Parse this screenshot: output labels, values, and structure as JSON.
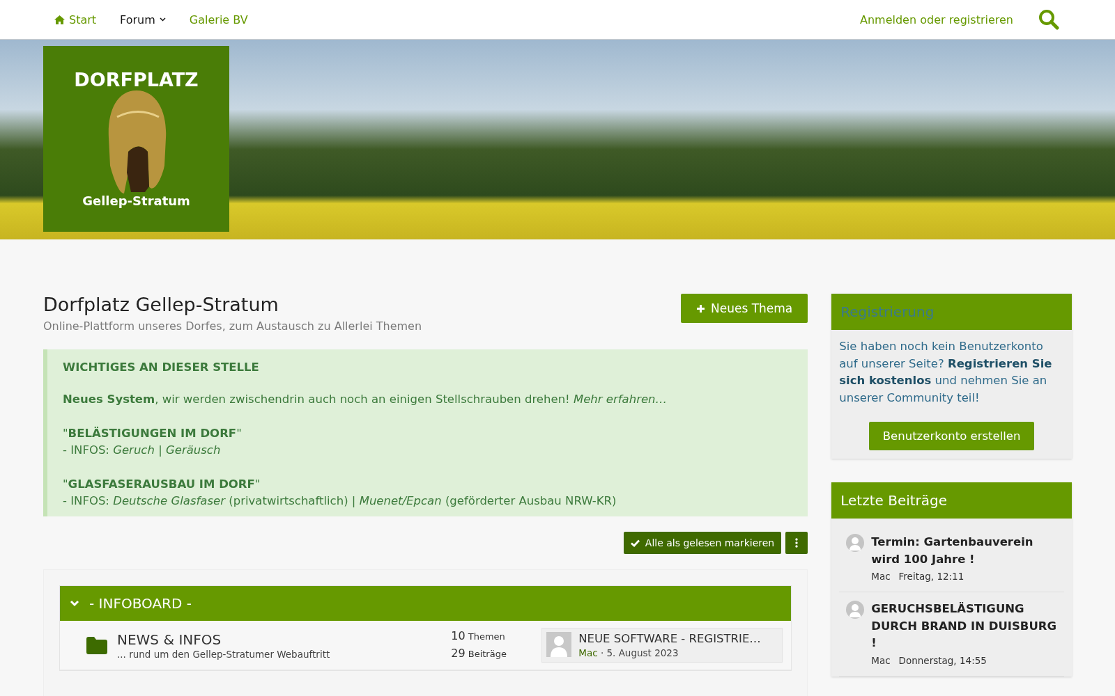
{
  "nav": {
    "items": [
      {
        "label": "Start",
        "kind": "home",
        "selected": false
      },
      {
        "label": "Forum",
        "kind": "menu",
        "selected": true
      },
      {
        "label": "Galerie BV",
        "kind": "plain",
        "selected": false
      }
    ],
    "login": "Anmelden oder registrieren"
  },
  "logo": {
    "top": "DORFPLATZ",
    "bottom": "Gellep-Stratum"
  },
  "page": {
    "title": "Dorfplatz Gellep-Stratum",
    "subtitle": "Online-Plattform unseres Dorfes, zum Austausch zu Allerlei Themen",
    "new_button": "Neues Thema"
  },
  "notice": {
    "heading": "WICHTIGES AN DIESER STELLE",
    "blocks": [
      [
        "**Neues System**, wir werden zwischendrin auch noch an einigen Stellschrauben drehen! *Mehr erfahren…*"
      ],
      [
        "\"**BELÄSTIGUNGEN IM DORF**\"",
        "- INFOS: *Geruch* | *Geräusch*"
      ],
      [
        "\"**GLASFASERAUSBAU IM DORF**\"",
        "- INFOS: *Deutsche Glasfaser* (privatwirtschaftlich) | *Muenet/Epcan* (geförderter Ausbau NRW-KR)"
      ]
    ]
  },
  "actions": {
    "mark_read": "Alle als gelesen markieren"
  },
  "category": {
    "title": "- INFOBOARD -",
    "expanded": true,
    "forums": [
      {
        "name": "NEWS & INFOS",
        "description": "... rund um den Gellep-Stratumer Webauftritt",
        "threads": "10",
        "threads_label": "Themen",
        "posts": "29",
        "posts_label": "Beiträge",
        "last_title": "NEUE SOFTWARE - REGISTRIE…",
        "last_user": "Mac",
        "last_date": "· 5. August 2023"
      }
    ]
  },
  "sidebar": {
    "register": {
      "title": "Registrierung",
      "text": "Sie haben noch kein Benutzerkonto auf unserer Seite? **Registrieren Sie sich kostenlos** und nehmen Sie an unserer Community teil!",
      "button": "Benutzerkonto erstellen"
    },
    "latest": {
      "title": "Letzte Beiträge",
      "posts": [
        {
          "title": "Termin: Gartenbauverein wird 100 Jahre !",
          "user": "Mac",
          "time": "Freitag, 12:11"
        },
        {
          "title": "GERUCHSBELÄSTIGUNG DURCH BRAND IN DUISBURG !",
          "user": "Mac",
          "time": "Donnerstag, 14:55"
        }
      ]
    }
  }
}
